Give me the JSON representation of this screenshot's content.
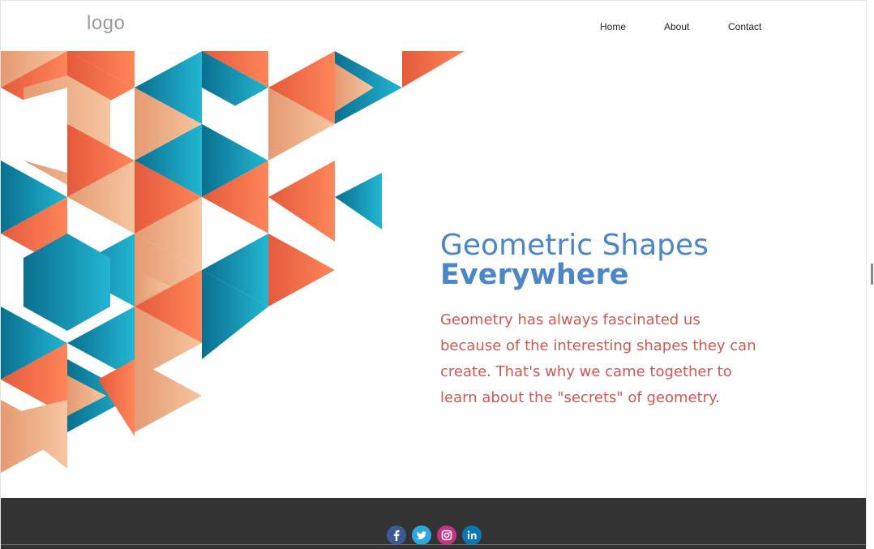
{
  "header": {
    "logo_text": "logo",
    "nav": [
      {
        "label": "Home"
      },
      {
        "label": "About"
      },
      {
        "label": "Contact"
      }
    ]
  },
  "hero": {
    "title_line1": "Geometric Shapes",
    "title_line2": "Everywhere",
    "paragraph": "Geometry has always fascinated us because of the interesting shapes they can create. That's why we came together to learn about the \"secrets\" of geometry."
  },
  "footer": {
    "social": [
      {
        "name": "facebook-icon",
        "color": "#3b5998"
      },
      {
        "name": "twitter-icon",
        "color": "#2da7e0"
      },
      {
        "name": "instagram-icon",
        "color": "#c13584"
      },
      {
        "name": "linkedin-icon",
        "color": "#0a77b5"
      }
    ]
  },
  "colors": {
    "title": "#4a86c8",
    "paragraph": "#d25652",
    "footer_bg": "#333333",
    "teal": "#1aa6c4",
    "orange": "#f26b4a",
    "peach": "#efb38a"
  }
}
